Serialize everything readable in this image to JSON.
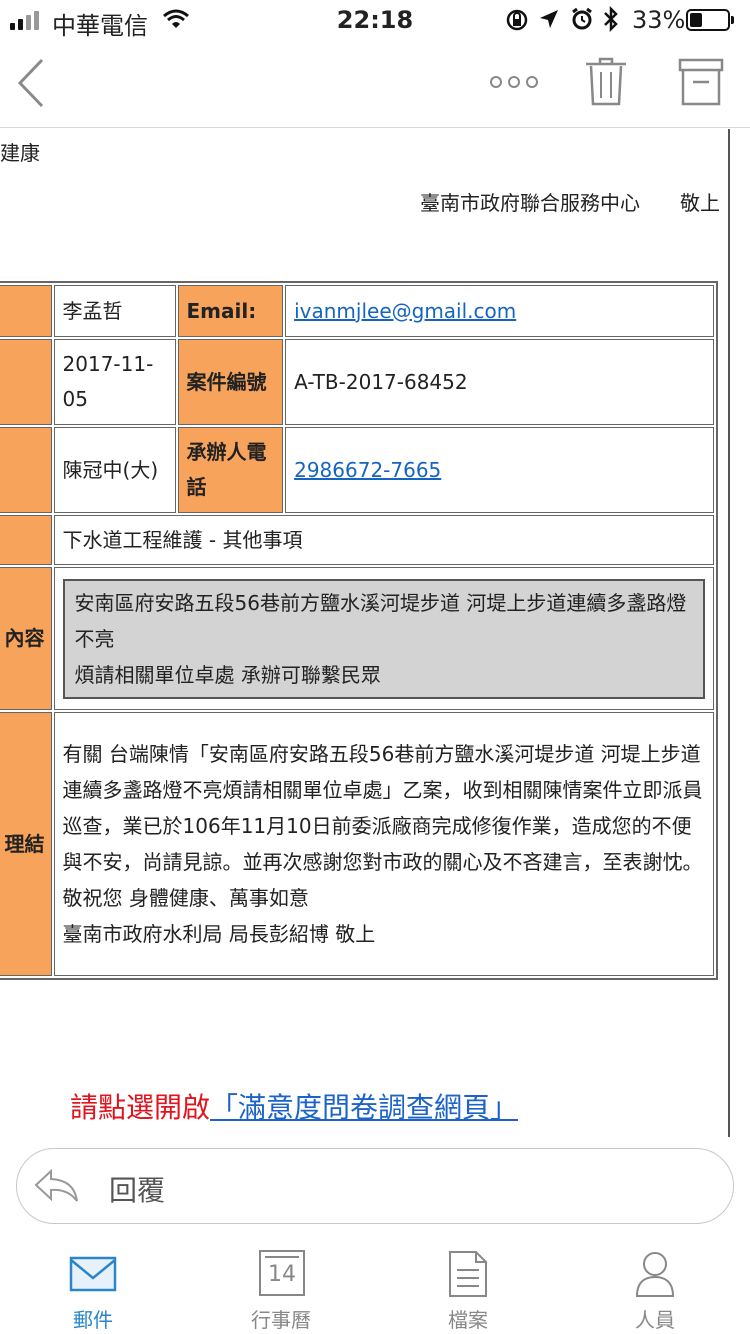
{
  "status_bar": {
    "carrier": "中華電信",
    "time": "22:18",
    "battery_percent": "33%",
    "battery_level": 0.33
  },
  "nav": {
    "back_icon": "chevron-left-icon",
    "more_icon": "more-dots-icon",
    "delete_icon": "trash-icon",
    "archive_icon": "archive-icon"
  },
  "mail": {
    "fragment_top": "建康",
    "signature": "臺南市政府聯合服務中心　　敬上",
    "table": {
      "rows": [
        {
          "c1": "李孟哲",
          "h2": "Email:",
          "c2": "ivanmjlee@gmail.com"
        },
        {
          "c1": "2017-11-05",
          "h2": "案件編號",
          "c2": "A-TB-2017-68452"
        },
        {
          "c1": "陳冠中(大)",
          "h2": "承辦人電話",
          "c2": "2986672-7665"
        }
      ],
      "category": "下水道工程維護 - 其他事項",
      "content_label": "內容",
      "content_line1": "安南區府安路五段56巷前方鹽水溪河堤步道 河堤上步道連續多盞路燈不亮",
      "content_line2": "煩請相關單位卓處 承辦可聯繫民眾",
      "result_label": "理結",
      "reply_p1": "有關 台端陳情「安南區府安路五段56巷前方鹽水溪河堤步道 河堤上步道連續多盞路燈不亮煩請相關單位卓處」乙案，收到相關陳情案件立即派員巡查，業已於106年11月10日前委派廠商完成修復作業，造成您的不便與不安，尚請見諒。並再次感謝您對市政的關心及不吝建言，至表謝忱。",
      "reply_p2": "敬祝您 身體健康、萬事如意",
      "reply_p3": "臺南市政府水利局 局長彭紹博 敬上"
    },
    "survey_prefix": "請點選開啟",
    "survey_link": "「滿意度問卷調查網頁」"
  },
  "reply": {
    "label": "回覆",
    "icon": "reply-arrow-icon"
  },
  "tabs": [
    {
      "label": "郵件",
      "icon": "mail-icon",
      "active": true
    },
    {
      "label": "行事曆",
      "icon": "calendar-icon",
      "date": "14",
      "active": false
    },
    {
      "label": "檔案",
      "icon": "file-icon",
      "active": false
    },
    {
      "label": "人員",
      "icon": "person-icon",
      "active": false
    }
  ],
  "colors": {
    "header_orange": "#f7a35c",
    "link_blue": "#1565c0",
    "survey_red": "#e0141e",
    "active_tab": "#2a86c9",
    "inactive_tab": "#888888"
  }
}
